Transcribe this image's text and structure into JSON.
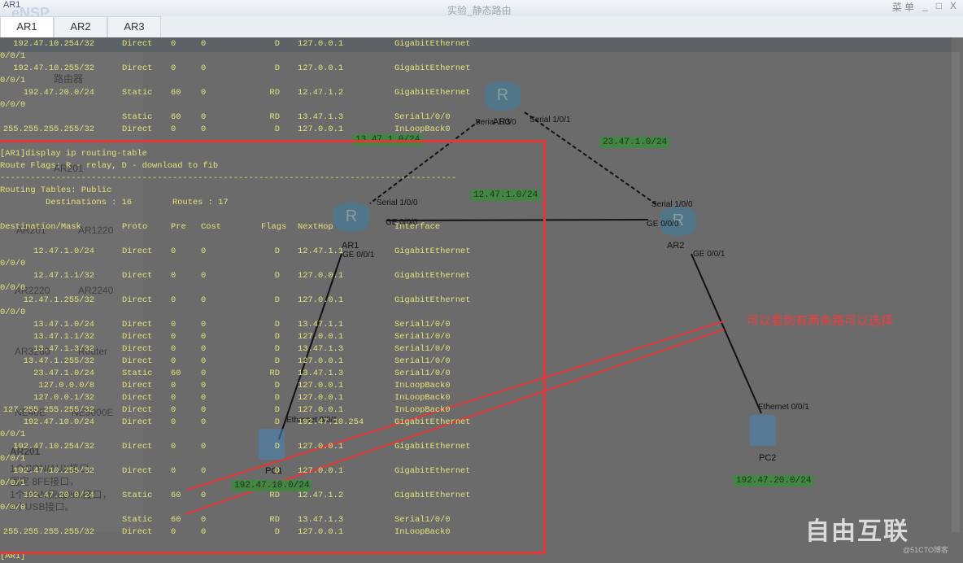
{
  "window": {
    "app_label": "AR1",
    "logo": "eNSP",
    "title": "实验_静态路由",
    "controls": [
      "菜 单",
      "_",
      "□",
      "X"
    ]
  },
  "tabs": [
    {
      "label": "AR1",
      "active": true
    },
    {
      "label": "AR2"
    },
    {
      "label": "AR3"
    }
  ],
  "device_panel": {
    "category": "路由器",
    "devices": [
      "AR201",
      "AR1220",
      "AR2220",
      "AR2240",
      "AR3260",
      "Router",
      "NE40E",
      "NE5000E"
    ],
    "selected_name": "AR201",
    "description": [
      "1个CON/AUX接口，",
      "固定 8FE接口，",
      "1个WAN侧uplink接口，",
      "2个USB接口。"
    ]
  },
  "topology": {
    "nodes": [
      {
        "name": "AR3"
      },
      {
        "name": "AR1"
      },
      {
        "name": "AR2"
      },
      {
        "name": "PC1"
      },
      {
        "name": "PC2"
      }
    ],
    "networks": [
      "13.47.1.0/24",
      "23.47.1.0/24",
      "12.47.1.0/24",
      "192.47.10.0/24",
      "192.47.20.0/24"
    ],
    "interfaces": [
      "Serial 1/0/0",
      "Serial 1/0/1",
      "Serial 1/0/0",
      "GE 0/0/0",
      "GE 0/0/1",
      "Serial 1/0/0",
      "GE 0/0/0",
      "GE 0/0/1",
      "Ethernet 0/0/1",
      "Ethernet 0/0/1"
    ]
  },
  "annotation": {
    "text": "可以看到有两条路可以选择",
    "color": "#f03c3c"
  },
  "watermark": {
    "text": "自由互联",
    "sub": "@51CTO博客"
  },
  "terminal": {
    "lines": [
      {
        "r": [
          "192.47.10.254/32",
          "Direct",
          "0",
          "0",
          "D",
          "127.0.0.1",
          "GigabitEthernet"
        ]
      },
      {
        "t": "0/0/1"
      },
      {
        "r": [
          "192.47.10.255/32",
          "Direct",
          "0",
          "0",
          "D",
          "127.0.0.1",
          "GigabitEthernet"
        ]
      },
      {
        "t": "0/0/1"
      },
      {
        "r": [
          "192.47.20.0/24",
          "Static",
          "60",
          "0",
          "RD",
          "12.47.1.2",
          "GigabitEthernet"
        ]
      },
      {
        "t": "0/0/0"
      },
      {
        "r": [
          "",
          "Static",
          "60",
          "0",
          "RD",
          "13.47.1.3",
          "Serial1/0/0"
        ]
      },
      {
        "r": [
          "255.255.255.255/32",
          "Direct",
          "0",
          "0",
          "D",
          "127.0.0.1",
          "InLoopBack0"
        ]
      },
      {
        "t": ""
      },
      {
        "t": "[AR1]display ip routing-table"
      },
      {
        "t": "Route Flags: R - relay, D - download to fib"
      },
      {
        "t": "------------------------------------------------------------------------------------------"
      },
      {
        "t": "Routing Tables: Public"
      },
      {
        "t": "         Destinations : 16        Routes : 17"
      },
      {
        "t": ""
      },
      {
        "h": [
          "Destination/Mask",
          "Proto",
          "Pre",
          "Cost",
          "Flags",
          "NextHop",
          "Interface"
        ]
      },
      {
        "t": ""
      },
      {
        "r": [
          "12.47.1.0/24",
          "Direct",
          "0",
          "0",
          "D",
          "12.47.1.1",
          "GigabitEthernet"
        ]
      },
      {
        "t": "0/0/0"
      },
      {
        "r": [
          "12.47.1.1/32",
          "Direct",
          "0",
          "0",
          "D",
          "127.0.0.1",
          "GigabitEthernet"
        ]
      },
      {
        "t": "0/0/0"
      },
      {
        "r": [
          "12.47.1.255/32",
          "Direct",
          "0",
          "0",
          "D",
          "127.0.0.1",
          "GigabitEthernet"
        ]
      },
      {
        "t": "0/0/0"
      },
      {
        "r": [
          "13.47.1.0/24",
          "Direct",
          "0",
          "0",
          "D",
          "13.47.1.1",
          "Serial1/0/0"
        ]
      },
      {
        "r": [
          "13.47.1.1/32",
          "Direct",
          "0",
          "0",
          "D",
          "127.0.0.1",
          "Serial1/0/0"
        ]
      },
      {
        "r": [
          "13.47.1.3/32",
          "Direct",
          "0",
          "0",
          "D",
          "13.47.1.3",
          "Serial1/0/0"
        ]
      },
      {
        "r": [
          "13.47.1.255/32",
          "Direct",
          "0",
          "0",
          "D",
          "127.0.0.1",
          "Serial1/0/0"
        ]
      },
      {
        "r": [
          "23.47.1.0/24",
          "Static",
          "60",
          "0",
          "RD",
          "13.47.1.3",
          "Serial1/0/0"
        ]
      },
      {
        "r": [
          "127.0.0.0/8",
          "Direct",
          "0",
          "0",
          "D",
          "127.0.0.1",
          "InLoopBack0"
        ]
      },
      {
        "r": [
          "127.0.0.1/32",
          "Direct",
          "0",
          "0",
          "D",
          "127.0.0.1",
          "InLoopBack0"
        ]
      },
      {
        "r": [
          "127.255.255.255/32",
          "Direct",
          "0",
          "0",
          "D",
          "127.0.0.1",
          "InLoopBack0"
        ]
      },
      {
        "r": [
          "192.47.10.0/24",
          "Direct",
          "0",
          "0",
          "D",
          "192.47.10.254",
          "GigabitEthernet"
        ]
      },
      {
        "t": "0/0/1"
      },
      {
        "r": [
          "192.47.10.254/32",
          "Direct",
          "0",
          "0",
          "D",
          "127.0.0.1",
          "GigabitEthernet"
        ]
      },
      {
        "t": "0/0/1"
      },
      {
        "r": [
          "192.47.10.255/32",
          "Direct",
          "0",
          "0",
          "D",
          "127.0.0.1",
          "GigabitEthernet"
        ]
      },
      {
        "t": "0/0/1"
      },
      {
        "r": [
          "192.47.20.0/24",
          "Static",
          "60",
          "0",
          "RD",
          "12.47.1.2",
          "GigabitEthernet"
        ]
      },
      {
        "t": "0/0/0"
      },
      {
        "r": [
          "",
          "Static",
          "60",
          "0",
          "RD",
          "13.47.1.3",
          "Serial1/0/0"
        ]
      },
      {
        "r": [
          "255.255.255.255/32",
          "Direct",
          "0",
          "0",
          "D",
          "127.0.0.1",
          "InLoopBack0"
        ]
      },
      {
        "t": ""
      },
      {
        "t": "[AR1]"
      }
    ]
  }
}
